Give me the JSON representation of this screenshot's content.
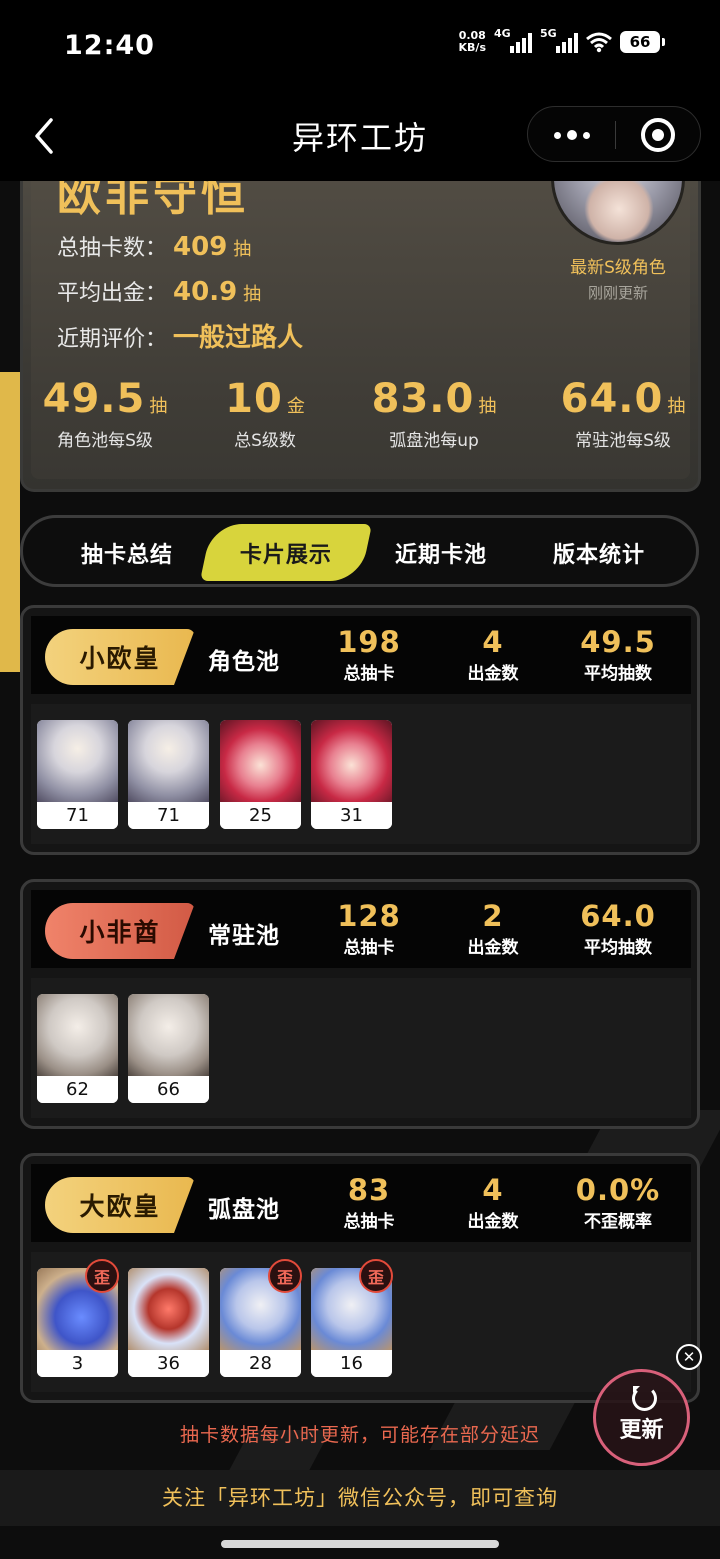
{
  "status": {
    "time": "12:40",
    "net_speed_top": "0.08",
    "net_speed_bottom": "KB/s",
    "sim1": "4G",
    "sim2": "5G",
    "battery": "66"
  },
  "nav": {
    "title": "异环工坊"
  },
  "summary": {
    "rating": "欧非守恒",
    "lines": [
      {
        "label": "总抽卡数：",
        "value": "409",
        "unit": "抽"
      },
      {
        "label": "平均出金：",
        "value": "40.9",
        "unit": "抽"
      },
      {
        "label": "近期评价：",
        "value": "一般过路人",
        "unit": ""
      }
    ],
    "newest_label": "最新S级角色",
    "updated_label": "刚刚更新",
    "big_stats": [
      {
        "value": "49.5",
        "unit": "抽",
        "caption": "角色池每S级"
      },
      {
        "value": "10",
        "unit": "金",
        "caption": "总S级数"
      },
      {
        "value": "83.0",
        "unit": "抽",
        "caption": "弧盘池每up"
      },
      {
        "value": "64.0",
        "unit": "抽",
        "caption": "常驻池每S级"
      }
    ]
  },
  "tabs": [
    "抽卡总结",
    "卡片展示",
    "近期卡池",
    "版本统计"
  ],
  "pools": [
    {
      "badge": "小欧皇",
      "name": "角色池",
      "stats": [
        {
          "value": "198",
          "label": "总抽卡"
        },
        {
          "value": "4",
          "label": "出金数"
        },
        {
          "value": "49.5",
          "label": "平均抽数"
        }
      ],
      "cards": [
        {
          "count": "71",
          "art": "silver"
        },
        {
          "count": "71",
          "art": "silver"
        },
        {
          "count": "25",
          "art": "redhair"
        },
        {
          "count": "31",
          "art": "redhair"
        }
      ]
    },
    {
      "badge": "小非酋",
      "name": "常驻池",
      "stats": [
        {
          "value": "128",
          "label": "总抽卡"
        },
        {
          "value": "2",
          "label": "出金数"
        },
        {
          "value": "64.0",
          "label": "平均抽数"
        }
      ],
      "cards": [
        {
          "count": "62",
          "art": "white"
        },
        {
          "count": "66",
          "art": "white"
        }
      ]
    },
    {
      "badge": "大欧皇",
      "name": "弧盘池",
      "stats": [
        {
          "value": "83",
          "label": "总抽卡"
        },
        {
          "value": "4",
          "label": "出金数"
        },
        {
          "value": "0.0%",
          "label": "不歪概率"
        }
      ],
      "cards": [
        {
          "count": "3",
          "art": "disk-blue",
          "tag": "歪"
        },
        {
          "count": "36",
          "art": "disk-red",
          "tag": ""
        },
        {
          "count": "28",
          "art": "disk-white",
          "tag": "歪"
        },
        {
          "count": "16",
          "art": "disk-white",
          "tag": "歪"
        }
      ]
    }
  ],
  "footer": {
    "delay_note": "抽卡数据每小时更新，可能存在部分延迟",
    "refresh_label": "更新",
    "close_glyph": "✕",
    "follow_text": "关注「异环工坊」微信公众号，即可查询"
  },
  "colors": {
    "gold": "#f0c05a",
    "active_tab": "#d8d43c",
    "warn_red": "#e9684f"
  }
}
